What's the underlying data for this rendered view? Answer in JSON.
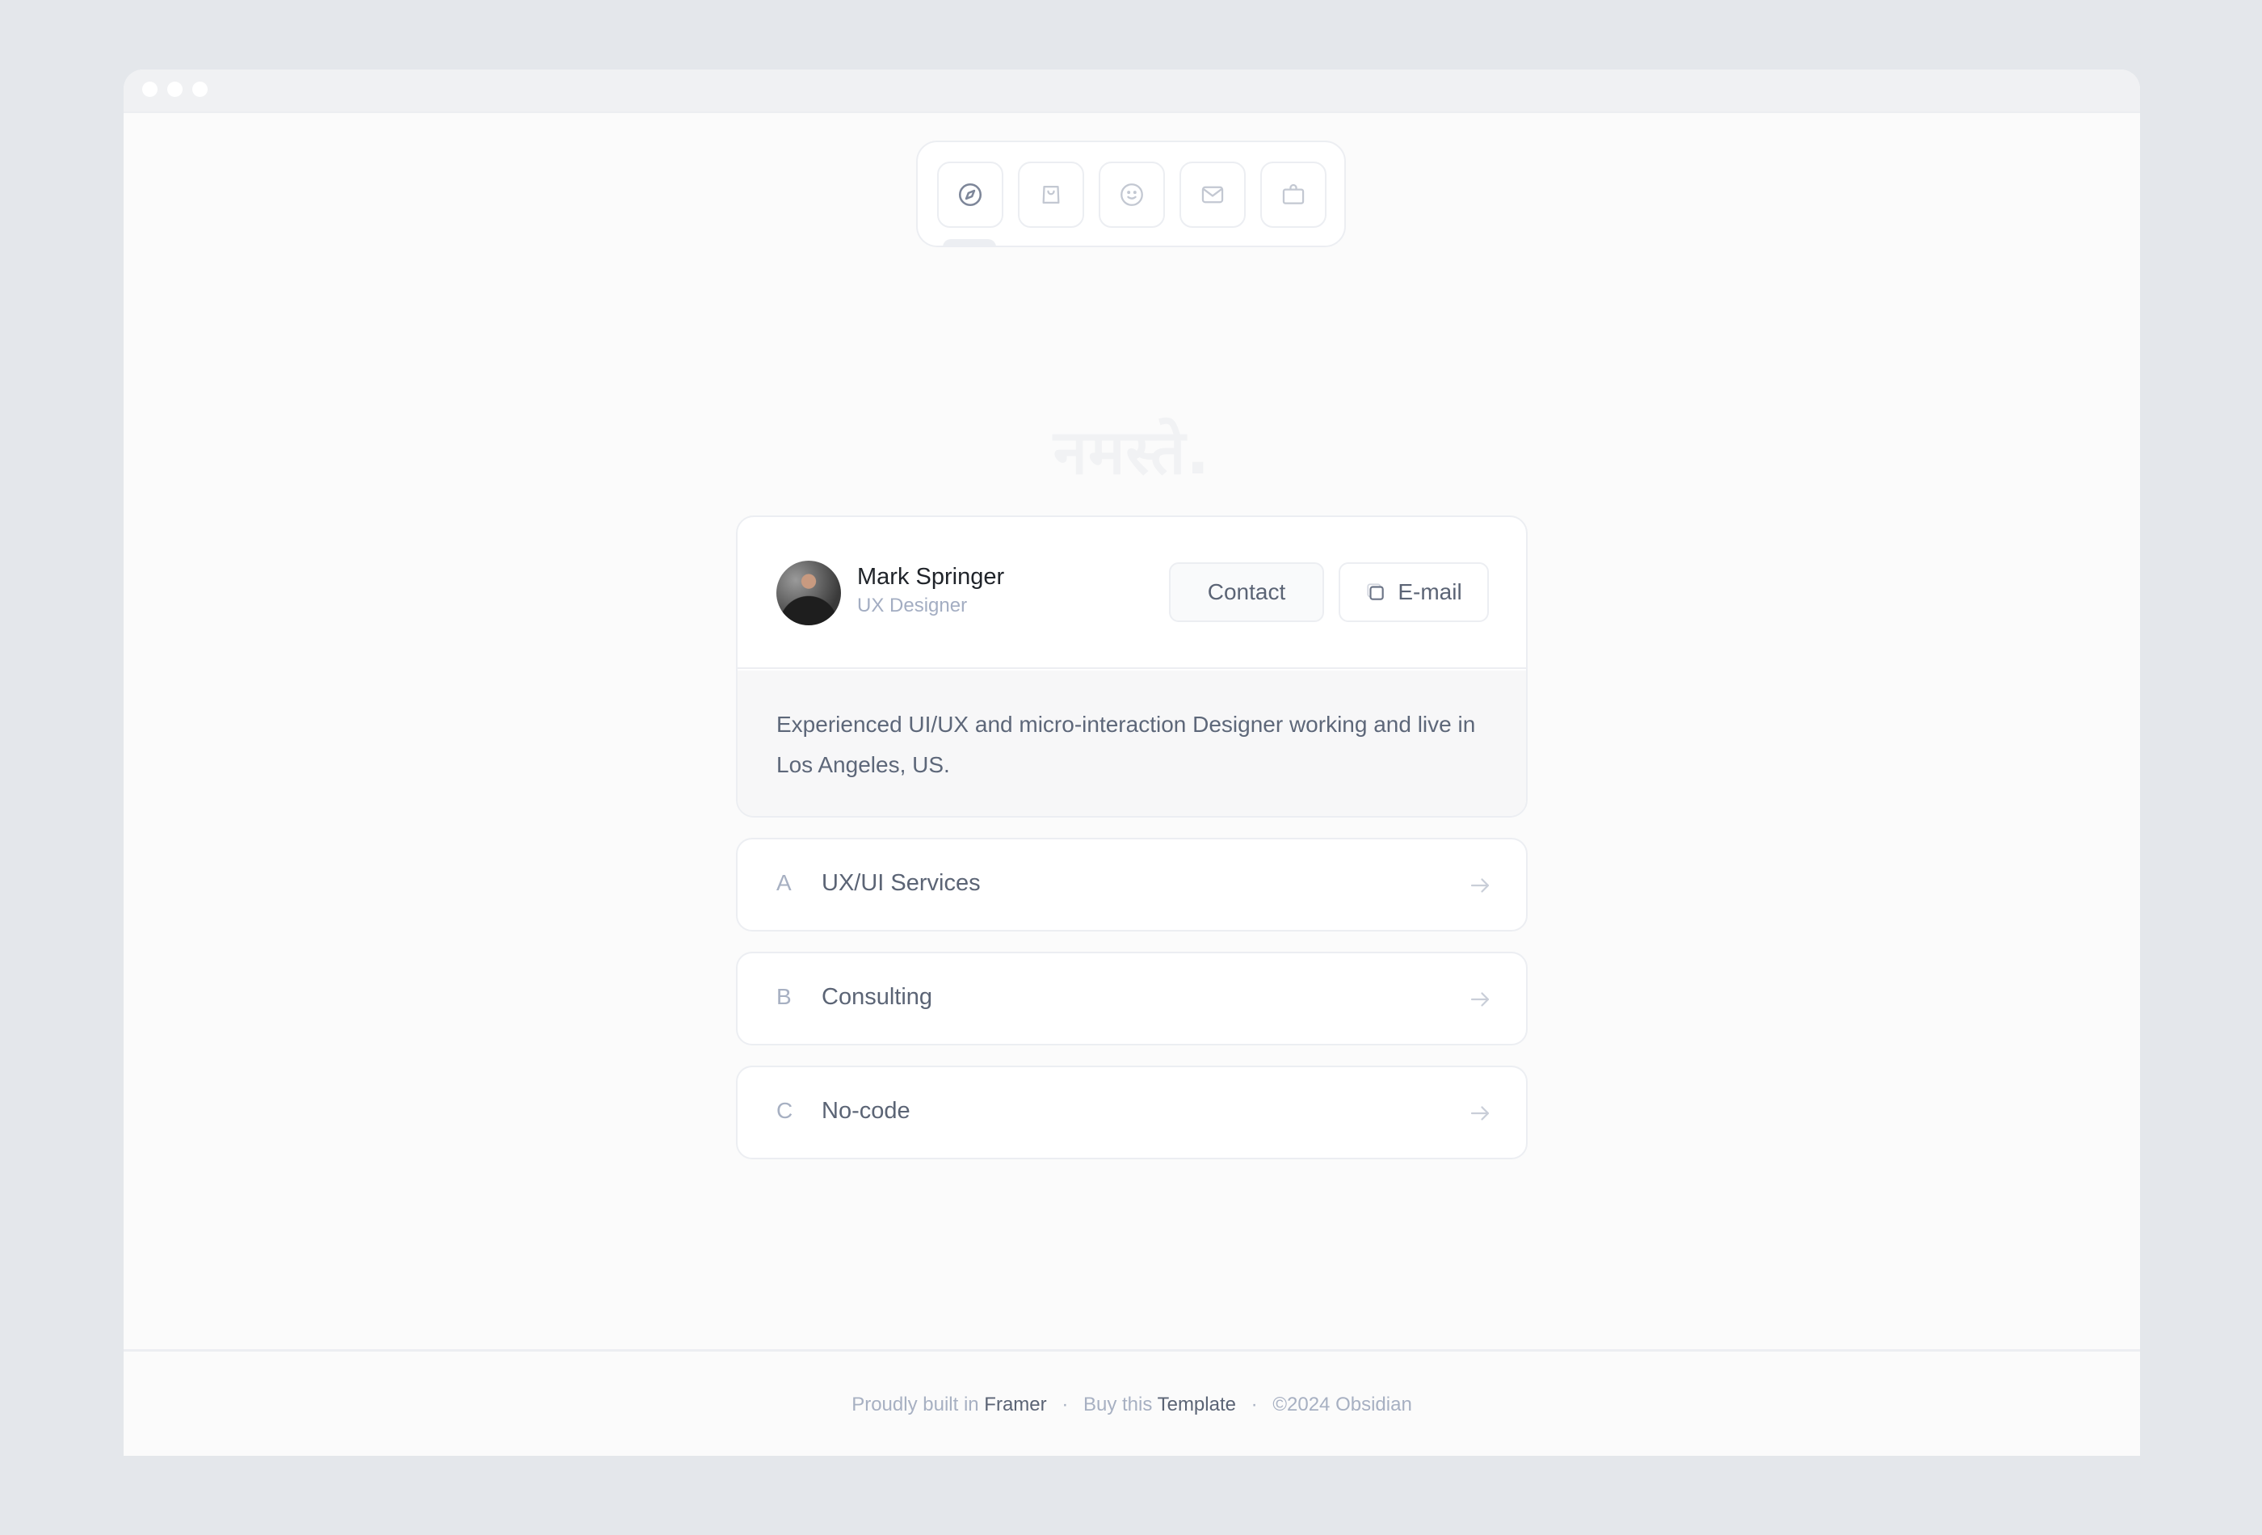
{
  "window": {
    "traffic_lights": [
      "close",
      "minimize",
      "maximize"
    ]
  },
  "dock": {
    "items": [
      {
        "name": "explore",
        "icon": "compass-icon",
        "active": true
      },
      {
        "name": "shop",
        "icon": "shopping-bag-icon",
        "active": false
      },
      {
        "name": "about",
        "icon": "smiley-icon",
        "active": false
      },
      {
        "name": "contact",
        "icon": "mail-icon",
        "active": false
      },
      {
        "name": "work",
        "icon": "briefcase-icon",
        "active": false
      }
    ]
  },
  "greeting": "नमस्ते.",
  "profile": {
    "name": "Mark Springer",
    "role": "UX Designer",
    "contact_label": "Contact",
    "email_label": "E-mail",
    "email_icon": "copy-icon",
    "bio": "Experienced UI/UX and micro-interaction Designer working and live in Los Angeles, US."
  },
  "services": [
    {
      "letter": "A",
      "label": "UX/UI Services"
    },
    {
      "letter": "B",
      "label": "Consulting"
    },
    {
      "letter": "C",
      "label": "No-code"
    }
  ],
  "footer": {
    "built_prefix": "Proudly built in",
    "built_link": "Framer",
    "separator": "·",
    "buy_prefix": "Buy this",
    "buy_link": "Template",
    "copyright": "©2024 Obsidian"
  },
  "colors": {
    "page_bg": "#e4e7eb",
    "window_bg": "#fbfbfb",
    "border": "#eceef2",
    "text_primary": "#1f2329",
    "text_secondary": "#5b6475",
    "text_muted": "#a7b0c2"
  }
}
